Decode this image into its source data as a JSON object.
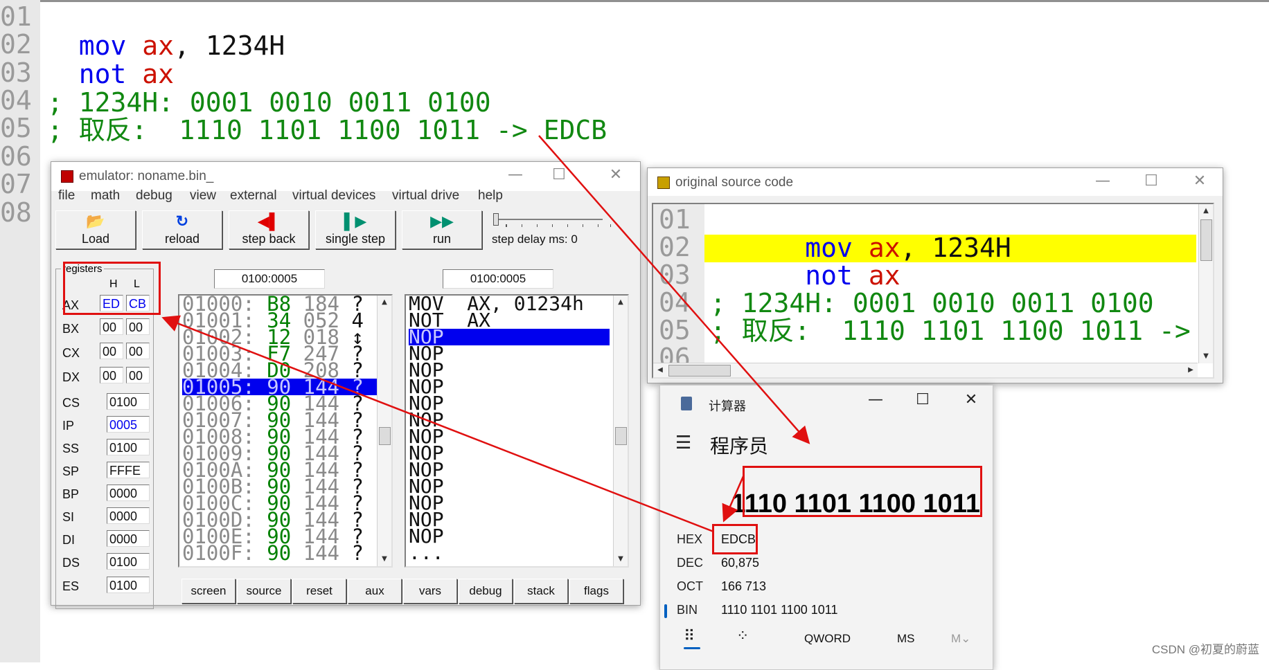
{
  "editor": {
    "line_numbers": [
      "01",
      "02",
      "03",
      "04",
      "05",
      "06",
      "07",
      "08"
    ],
    "line1": {
      "kw": "mov",
      "reg": "ax",
      "rest": ", 1234H"
    },
    "line2": {
      "kw": "not",
      "reg": "ax"
    },
    "line4": "; 1234H: 0001 0010 0011 0100",
    "line5": "; 取反:  1110 1101 1100 1011 -> EDCB"
  },
  "emulator": {
    "title": "emulator: noname.bin_",
    "menu": [
      "file",
      "math",
      "debug",
      "view",
      "external",
      "virtual devices",
      "virtual drive",
      "help"
    ],
    "toolbar": {
      "load": "Load",
      "reload": "reload",
      "step_back": "step back",
      "single_step": "single step",
      "run": "run",
      "step_delay": "step delay ms: 0"
    },
    "address_left": "0100:0005",
    "address_right": "0100:0005",
    "registers": {
      "group_label": "registers",
      "h_label": "H",
      "l_label": "L",
      "ax": {
        "name": "AX",
        "h": "ED",
        "l": "CB"
      },
      "bx": {
        "name": "BX",
        "h": "00",
        "l": "00"
      },
      "cx": {
        "name": "CX",
        "h": "00",
        "l": "00"
      },
      "dx": {
        "name": "DX",
        "h": "00",
        "l": "00"
      },
      "cs": {
        "name": "CS",
        "value": "0100"
      },
      "ip": {
        "name": "IP",
        "value": "0005"
      },
      "ss": {
        "name": "SS",
        "value": "0100"
      },
      "sp": {
        "name": "SP",
        "value": "FFFE"
      },
      "bp": {
        "name": "BP",
        "value": "0000"
      },
      "si": {
        "name": "SI",
        "value": "0000"
      },
      "di": {
        "name": "DI",
        "value": "0000"
      },
      "ds": {
        "name": "DS",
        "value": "0100"
      },
      "es": {
        "name": "ES",
        "value": "0100"
      }
    },
    "memory": [
      {
        "addr": "01000:",
        "hex": "B8",
        "dec": "184",
        "chr": "?"
      },
      {
        "addr": "01001:",
        "hex": "34",
        "dec": "052",
        "chr": "4"
      },
      {
        "addr": "01002:",
        "hex": "12",
        "dec": "018",
        "chr": "↕"
      },
      {
        "addr": "01003:",
        "hex": "F7",
        "dec": "247",
        "chr": "?"
      },
      {
        "addr": "01004:",
        "hex": "D0",
        "dec": "208",
        "chr": "?"
      },
      {
        "addr": "01005:",
        "hex": "90",
        "dec": "144",
        "chr": "?"
      },
      {
        "addr": "01006:",
        "hex": "90",
        "dec": "144",
        "chr": "?"
      },
      {
        "addr": "01007:",
        "hex": "90",
        "dec": "144",
        "chr": "?"
      },
      {
        "addr": "01008:",
        "hex": "90",
        "dec": "144",
        "chr": "?"
      },
      {
        "addr": "01009:",
        "hex": "90",
        "dec": "144",
        "chr": "?"
      },
      {
        "addr": "0100A:",
        "hex": "90",
        "dec": "144",
        "chr": "?"
      },
      {
        "addr": "0100B:",
        "hex": "90",
        "dec": "144",
        "chr": "?"
      },
      {
        "addr": "0100C:",
        "hex": "90",
        "dec": "144",
        "chr": "?"
      },
      {
        "addr": "0100D:",
        "hex": "90",
        "dec": "144",
        "chr": "?"
      },
      {
        "addr": "0100E:",
        "hex": "90",
        "dec": "144",
        "chr": "?"
      },
      {
        "addr": "0100F:",
        "hex": "90",
        "dec": "144",
        "chr": "?"
      }
    ],
    "disasm": [
      "MOV  AX, 01234h",
      "NOT  AX",
      "NOP",
      "NOP",
      "NOP",
      "NOP",
      "NOP",
      "NOP",
      "NOP",
      "NOP",
      "NOP",
      "NOP",
      "NOP",
      "NOP",
      "NOP",
      "..."
    ],
    "bottom_buttons": [
      "screen",
      "source",
      "reset",
      "aux",
      "vars",
      "debug",
      "stack",
      "flags"
    ]
  },
  "source_window": {
    "title": "original source code",
    "line_numbers": [
      "01",
      "02",
      "03",
      "04",
      "05",
      "06"
    ],
    "line1": {
      "kw": "mov",
      "reg": "ax",
      "rest": ", 1234H"
    },
    "line2": {
      "kw": "not",
      "reg": "ax"
    },
    "line4": "; 1234H: 0001 0010 0011 0100",
    "line5": "; 取反:  1110 1101 1100 1011 ->"
  },
  "calculator": {
    "title": "计算器",
    "mode": "程序员",
    "display": "1110 1101 1100 1011",
    "rows": [
      {
        "label": "HEX",
        "value": "EDCB"
      },
      {
        "label": "DEC",
        "value": "60,875"
      },
      {
        "label": "OCT",
        "value": "166 713"
      },
      {
        "label": "BIN",
        "value": "1110 1101 1100 1011"
      }
    ],
    "bottom": {
      "qword": "QWORD",
      "ms": "MS",
      "mv": "M⌄"
    }
  },
  "watermark": "CSDN @初夏的蔚蓝",
  "colors": {
    "highlight": "#ffff00",
    "selection": "#0000ee",
    "annotation": "#e01010",
    "comment": "#118811",
    "keyword": "#0000ee",
    "register": "#cc1100"
  }
}
